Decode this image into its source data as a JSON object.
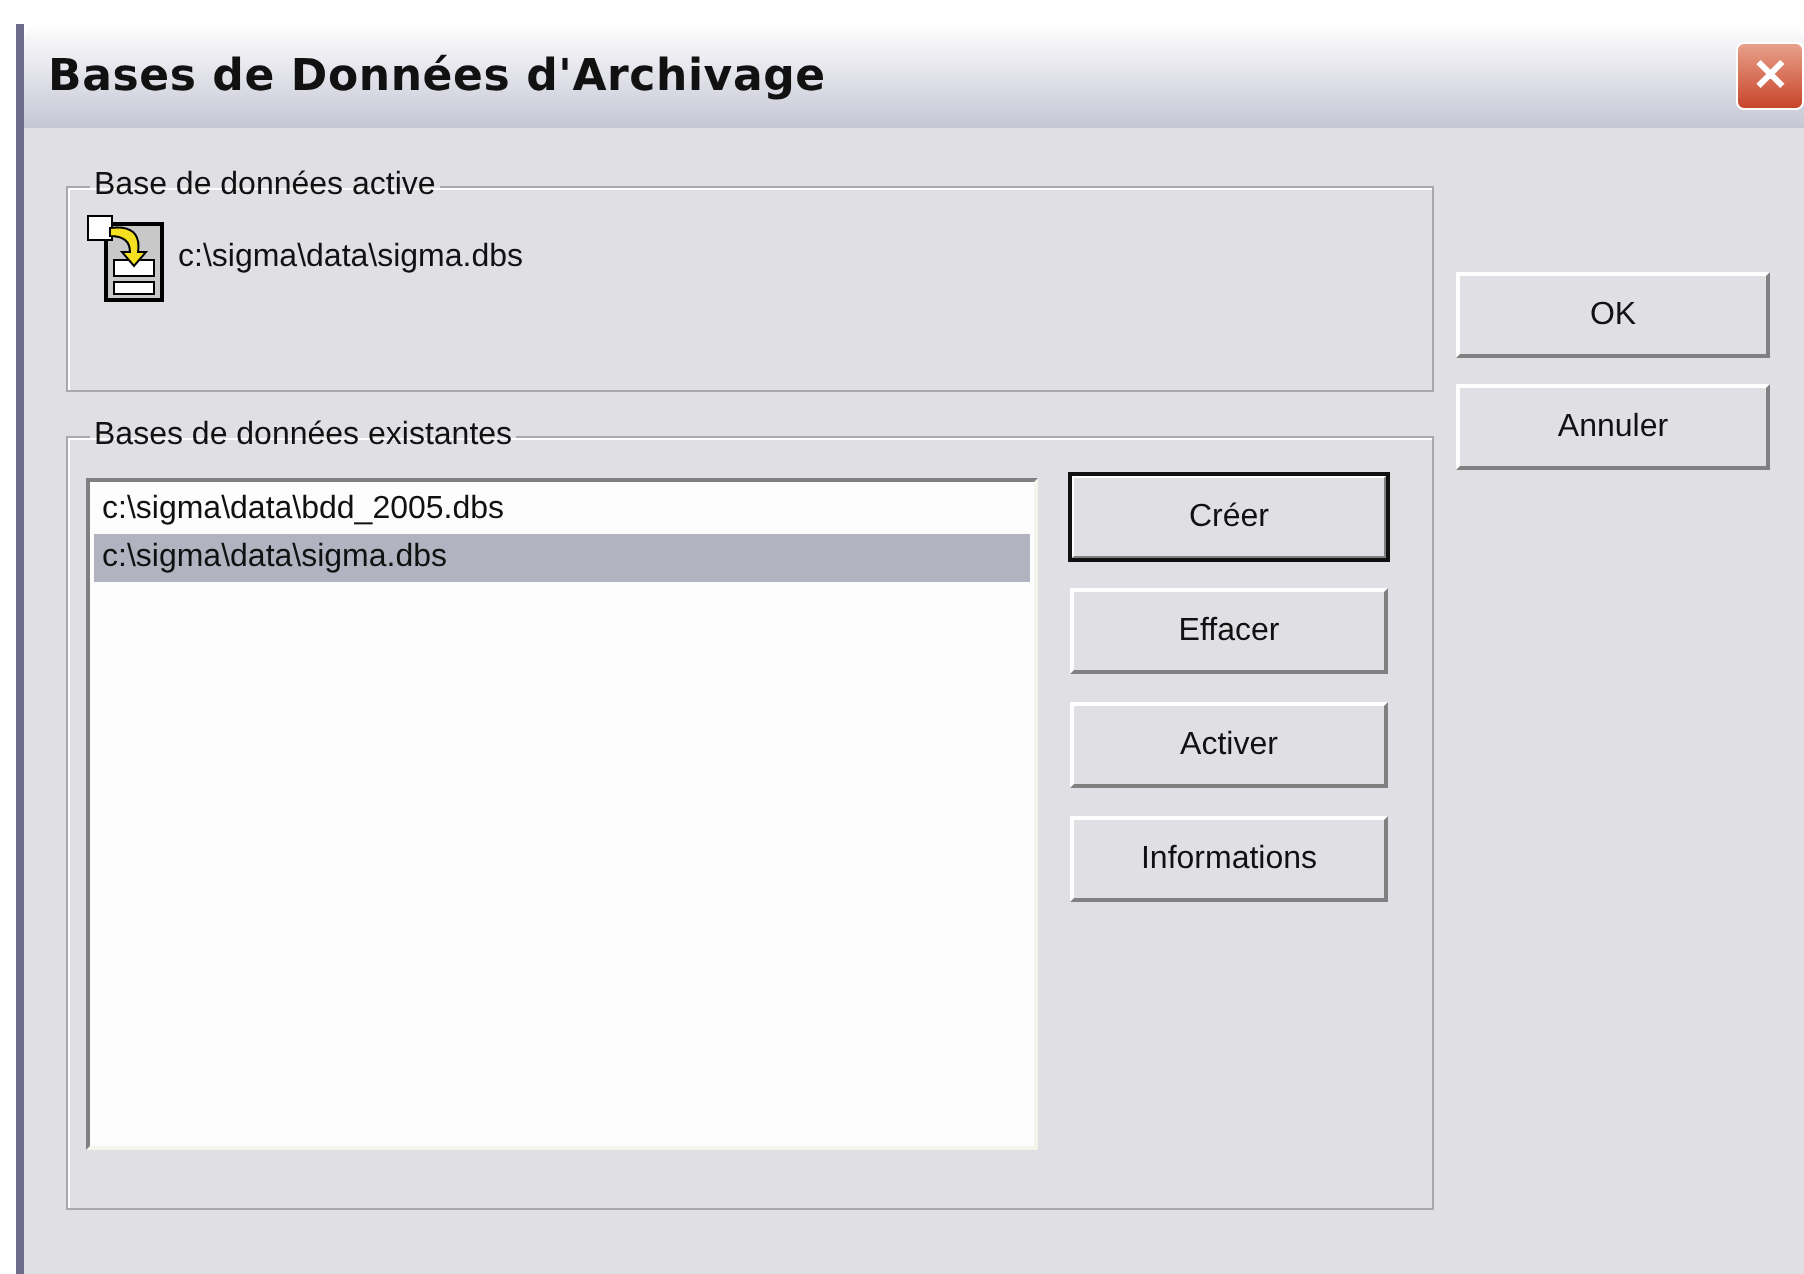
{
  "window": {
    "title": "Bases de Données d'Archivage",
    "close_glyph": "✕"
  },
  "active_group": {
    "label": "Base de données active",
    "path": "c:\\sigma\\data\\sigma.dbs"
  },
  "existing_group": {
    "label": "Bases de données existantes",
    "items": [
      {
        "text": "c:\\sigma\\data\\bdd_2005.dbs",
        "selected": false
      },
      {
        "text": "c:\\sigma\\data\\sigma.dbs",
        "selected": true
      }
    ],
    "buttons": [
      {
        "label": "Créer",
        "default": true
      },
      {
        "label": "Effacer",
        "default": false
      },
      {
        "label": "Activer",
        "default": false
      },
      {
        "label": "Informations",
        "default": false
      }
    ]
  },
  "dialog_buttons": [
    "OK",
    "Annuler"
  ]
}
